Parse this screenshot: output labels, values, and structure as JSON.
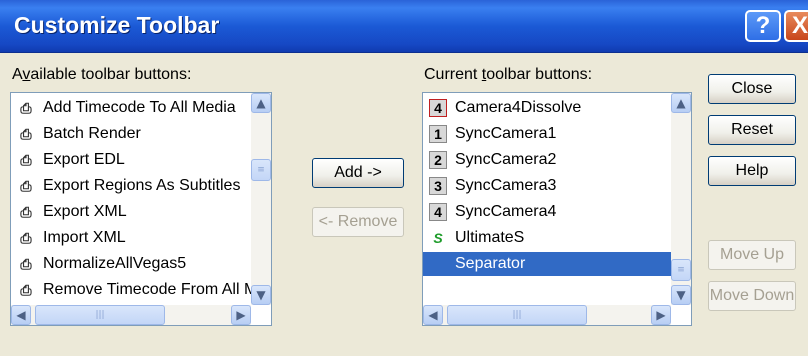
{
  "window": {
    "title": "Customize Toolbar",
    "help_glyph": "?",
    "close_glyph": "X"
  },
  "available": {
    "label": "Available toolbar buttons:",
    "label_mnemonic": "v",
    "items": [
      {
        "label": "Add Timecode To All Media",
        "icon": "script-icon"
      },
      {
        "label": "Batch Render",
        "icon": "script-icon"
      },
      {
        "label": "Export EDL",
        "icon": "script-icon"
      },
      {
        "label": "Export Regions As Subtitles",
        "icon": "script-icon"
      },
      {
        "label": "Export XML",
        "icon": "script-icon"
      },
      {
        "label": "Import XML",
        "icon": "script-icon"
      },
      {
        "label": "NormalizeAllVegas5",
        "icon": "script-icon"
      },
      {
        "label": "Remove Timecode From All M",
        "icon": "script-icon"
      }
    ]
  },
  "current": {
    "label": "Current toolbar buttons:",
    "label_mnemonic": "t",
    "items": [
      {
        "label": "Camera4Dissolve",
        "icon": "number-4-icon",
        "glyph": "4"
      },
      {
        "label": "SyncCamera1",
        "icon": "number-1-icon",
        "glyph": "1"
      },
      {
        "label": "SyncCamera2",
        "icon": "number-2-icon",
        "glyph": "2"
      },
      {
        "label": "SyncCamera3",
        "icon": "number-3-icon",
        "glyph": "3"
      },
      {
        "label": "SyncCamera4",
        "icon": "number-4-icon",
        "glyph": "4"
      },
      {
        "label": "UltimateS",
        "icon": "ultimate-s-icon",
        "glyph": "S"
      },
      {
        "label": "Separator",
        "icon": "",
        "glyph": "",
        "selected": true
      }
    ]
  },
  "buttons": {
    "add": "Add ->",
    "remove": "<- Remove",
    "close": "Close",
    "reset": "Reset",
    "help": "Help",
    "move_up": "Move Up",
    "move_down": "Move Down"
  },
  "colors": {
    "title_bar": "#1b5ad6",
    "selection": "#316ac5",
    "dialog_bg": "#ece9d8"
  }
}
